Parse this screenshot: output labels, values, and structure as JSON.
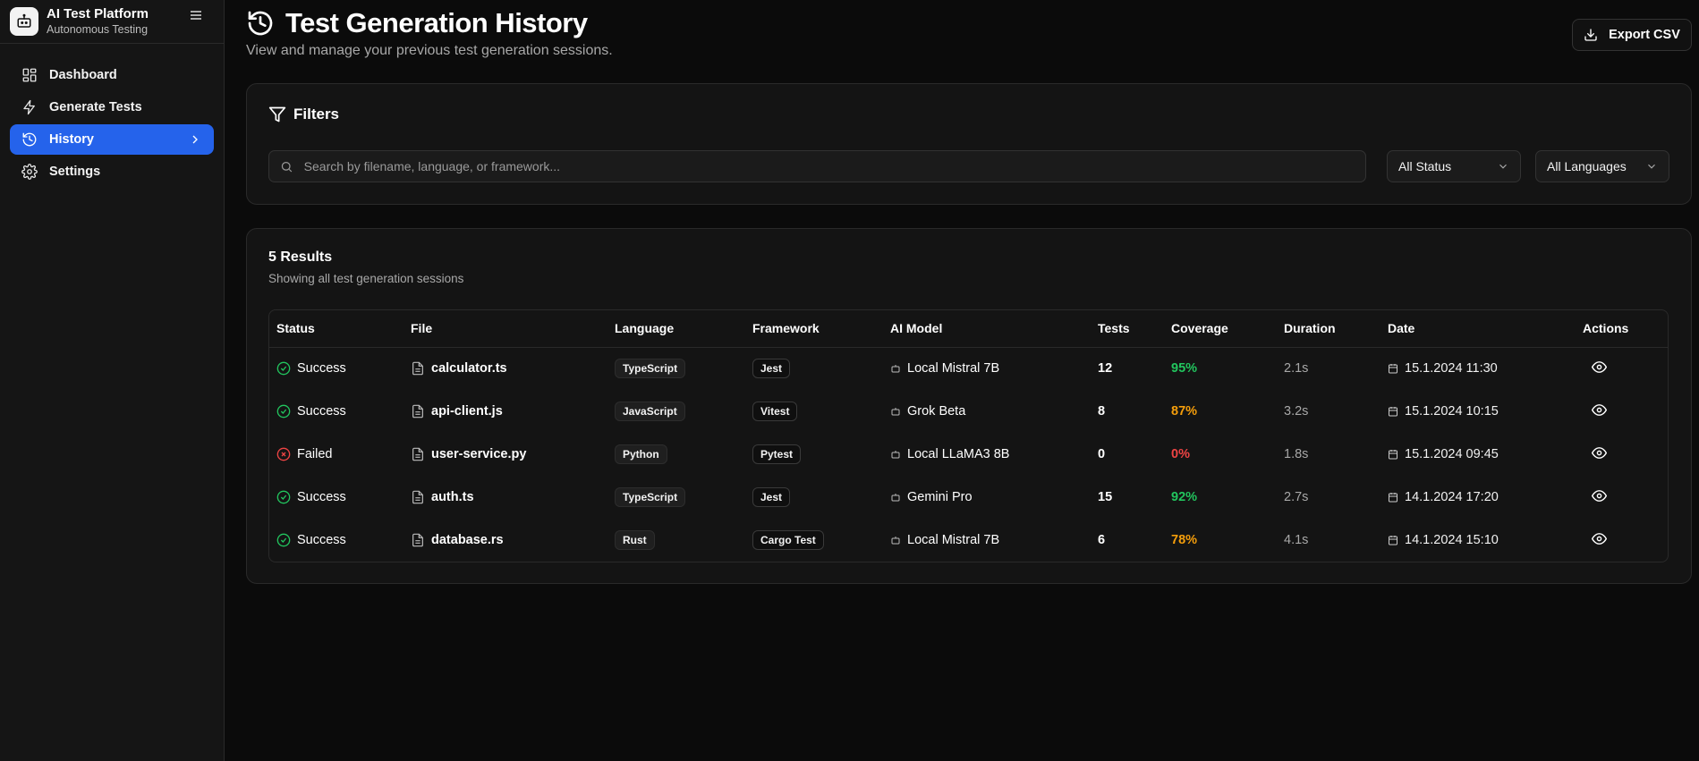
{
  "brand": {
    "title": "AI Test Platform",
    "subtitle": "Autonomous Testing",
    "icon": "robot-icon"
  },
  "nav": {
    "items": [
      {
        "label": "Dashboard",
        "icon": "grid-icon"
      },
      {
        "label": "Generate Tests",
        "icon": "lightning-icon"
      },
      {
        "label": "History",
        "icon": "history-icon",
        "active": true
      },
      {
        "label": "Settings",
        "icon": "gear-icon"
      }
    ]
  },
  "header": {
    "title": "Test Generation History",
    "subtitle": "View and manage your previous test generation sessions.",
    "export_label": "Export CSV"
  },
  "filters": {
    "title": "Filters",
    "search_placeholder": "Search by filename, language, or framework...",
    "status_selected": "All Status",
    "language_selected": "All Languages"
  },
  "results": {
    "title": "5 Results",
    "subtitle": "Showing all test generation sessions",
    "columns": [
      "Status",
      "File",
      "Language",
      "Framework",
      "AI Model",
      "Tests",
      "Coverage",
      "Duration",
      "Date",
      "Actions"
    ],
    "rows": [
      {
        "status": "Success",
        "file": "calculator.ts",
        "language": "TypeScript",
        "framework": "Jest",
        "model": "Local Mistral 7B",
        "tests": "12",
        "coverage": "95%",
        "duration": "2.1s",
        "date": "15.1.2024 11:30"
      },
      {
        "status": "Success",
        "file": "api-client.js",
        "language": "JavaScript",
        "framework": "Vitest",
        "model": "Grok Beta",
        "tests": "8",
        "coverage": "87%",
        "duration": "3.2s",
        "date": "15.1.2024 10:15"
      },
      {
        "status": "Failed",
        "file": "user-service.py",
        "language": "Python",
        "framework": "Pytest",
        "model": "Local LLaMA3 8B",
        "tests": "0",
        "coverage": "0%",
        "duration": "1.8s",
        "date": "15.1.2024 09:45"
      },
      {
        "status": "Success",
        "file": "auth.ts",
        "language": "TypeScript",
        "framework": "Jest",
        "model": "Gemini Pro",
        "tests": "15",
        "coverage": "92%",
        "duration": "2.7s",
        "date": "14.1.2024 17:20"
      },
      {
        "status": "Success",
        "file": "database.rs",
        "language": "Rust",
        "framework": "Cargo Test",
        "model": "Local Mistral 7B",
        "tests": "6",
        "coverage": "78%",
        "duration": "4.1s",
        "date": "14.1.2024 15:10"
      }
    ]
  },
  "colors": {
    "accent": "#2563eb",
    "success": "#22c55e",
    "warning": "#f59e0b",
    "danger": "#ef4444"
  }
}
